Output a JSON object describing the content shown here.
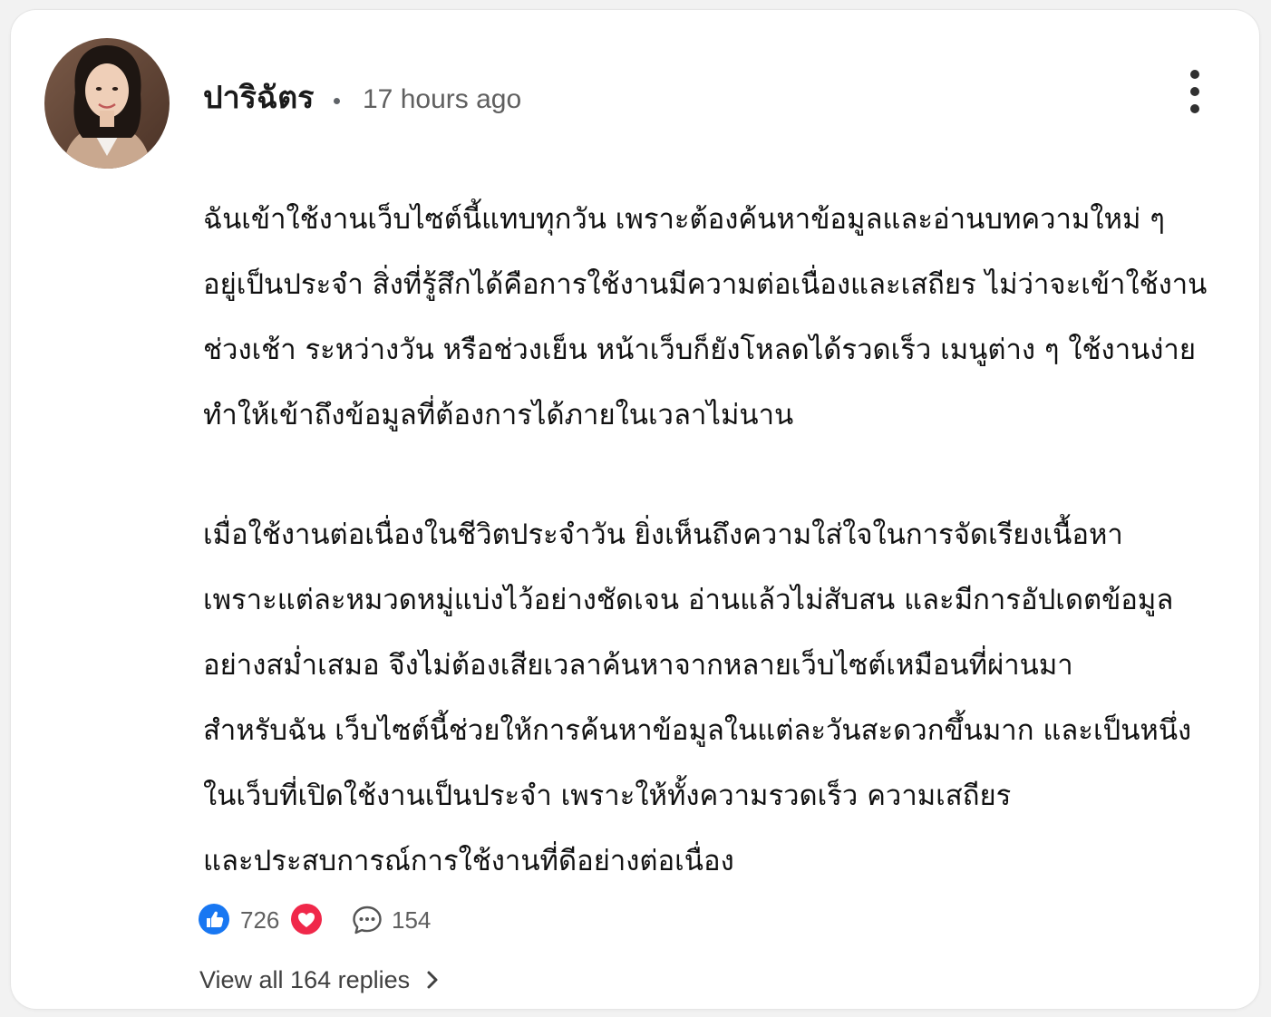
{
  "comment": {
    "author": "ปาริฉัตร",
    "separator": "•",
    "timestamp": "17 hours ago",
    "paragraph1": [
      "ฉันเข้าใช้งานเว็บไซต์นี้แทบทุกวัน เพราะต้องค้นหาข้อมูลและอ่านบทความใหม่ ๆ",
      "อยู่เป็นประจำ สิ่งที่รู้สึกได้คือการใช้งานมีความต่อเนื่องและเสถียร ไม่ว่าจะเข้าใช้งาน",
      "ช่วงเช้า ระหว่างวัน หรือช่วงเย็น หน้าเว็บก็ยังโหลดได้รวดเร็ว เมนูต่าง ๆ ใช้งานง่าย",
      "ทำให้เข้าถึงข้อมูลที่ต้องการได้ภายในเวลาไม่นาน"
    ],
    "paragraph2": [
      "เมื่อใช้งานต่อเนื่องในชีวิตประจำวัน ยิ่งเห็นถึงความใส่ใจในการจัดเรียงเนื้อหา",
      "เพราะแต่ละหมวดหมู่แบ่งไว้อย่างชัดเจน อ่านแล้วไม่สับสน และมีการอัปเดตข้อมูล",
      "อย่างสม่ำเสมอ จึงไม่ต้องเสียเวลาค้นหาจากหลายเว็บไซต์เหมือนที่ผ่านมา",
      "สำหรับฉัน เว็บไซต์นี้ช่วยให้การค้นหาข้อมูลในแต่ละวันสะดวกขึ้นมาก และเป็นหนึ่ง",
      "ในเว็บที่เปิดใช้งานเป็นประจำ เพราะให้ทั้งความรวดเร็ว ความเสถียร",
      "และประสบการณ์การใช้งานที่ดีอย่างต่อเนื่อง"
    ]
  },
  "reactions": {
    "like_icon": "thumbs-up-icon",
    "heart_icon": "heart-icon",
    "reaction_count": "726",
    "comment_icon": "speech-bubble-icon",
    "comment_count": "154"
  },
  "replies": {
    "label": "View all 164 replies",
    "icon": "chevron-right-icon"
  },
  "colors": {
    "like_blue": "#1877f2",
    "heart_red": "#f0284a",
    "muted_text": "#606060",
    "body_text": "#111111"
  }
}
